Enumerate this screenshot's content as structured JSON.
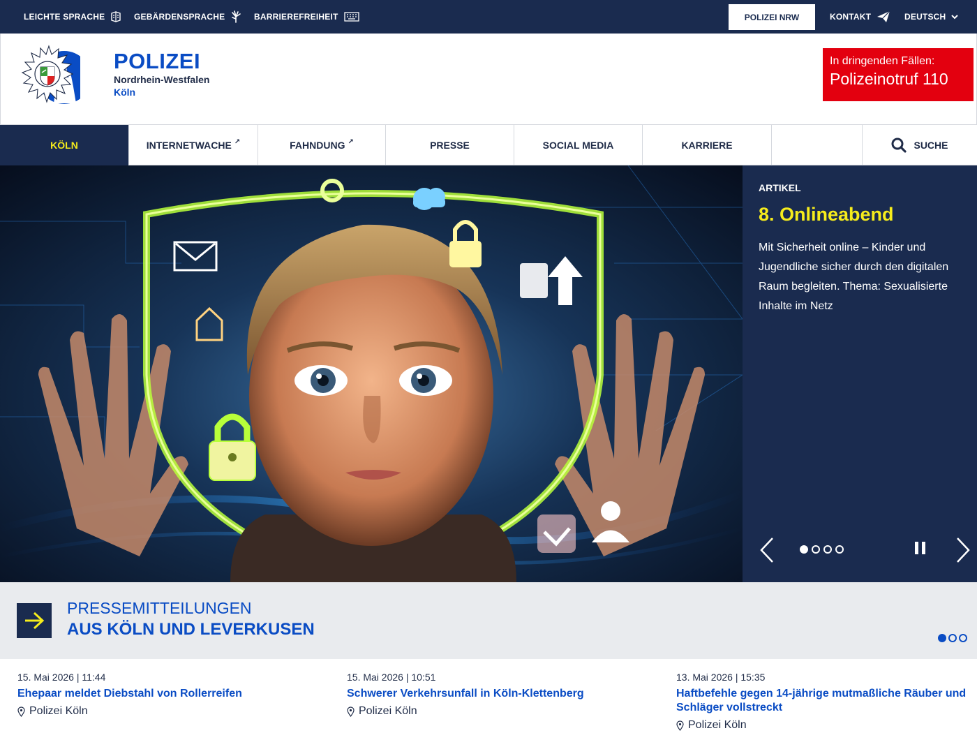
{
  "topbar": {
    "easy_language": "LEICHTE SPRACHE",
    "sign_language": "GEBÄRDENSPRACHE",
    "accessibility": "BARRIEREFREIHEIT",
    "polizei_nrw": "POLIZEI NRW",
    "contact": "KONTAKT",
    "language": "DEUTSCH"
  },
  "header": {
    "title": "POLIZEI",
    "region": "Nordrhein-Westfalen",
    "city": "Köln",
    "emergency_line1": "In dringenden Fällen:",
    "emergency_line2": "Polizeinotruf 110"
  },
  "nav": {
    "items": [
      {
        "label": "KÖLN"
      },
      {
        "label": "INTERNETWACHE"
      },
      {
        "label": "FAHNDUNG"
      },
      {
        "label": "PRESSE"
      },
      {
        "label": "SOCIAL MEDIA"
      },
      {
        "label": "KARRIERE"
      }
    ],
    "search": "SUCHE"
  },
  "hero": {
    "kicker": "ARTIKEL",
    "headline": "8. Onlineabend",
    "teaser": "Mit Sicherheit online – Kinder und Jugendliche sicher durch den digitalen Raum begleiten. Thema: Sexualisierte Inhalte im Netz",
    "slides_total": 4,
    "slide_active": 1
  },
  "press": {
    "heading_line1": "PRESSEMITTEILUNGEN",
    "heading_line2": "AUS KÖLN UND LEVERKUSEN"
  },
  "news": [
    {
      "date": "15. Mai 2026 | 11:44",
      "title": "Ehepaar meldet Diebstahl von Rollerreifen",
      "location": "Polizei Köln"
    },
    {
      "date": "15. Mai 2026 | 10:51",
      "title": "Schwerer Verkehrsunfall in Köln-Klettenberg",
      "location": "Polizei Köln"
    },
    {
      "date": "13. Mai 2026 | 15:35",
      "title": "Haftbefehle gegen 14-jährige mutmaßliche Räuber und Schläger vollstreckt",
      "location": "Polizei Köln"
    }
  ],
  "colors": {
    "navy": "#1a2b4f",
    "accent_blue": "#0a4cc4",
    "highlight_yellow": "#f6ec1c",
    "emergency_red": "#e3000f"
  }
}
